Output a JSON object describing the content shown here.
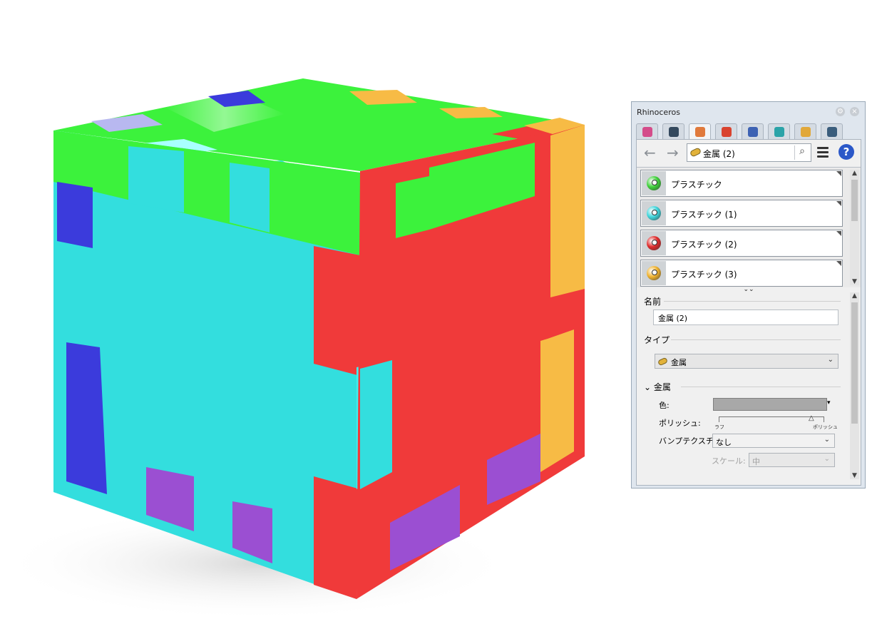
{
  "panel": {
    "title": "Rhinoceros",
    "tabs": [
      {
        "icon": "color-wheel-icon",
        "color": "#d44c8a"
      },
      {
        "icon": "environment-sphere-icon",
        "color": "#34495e"
      },
      {
        "icon": "materials-brush-icon",
        "color": "#e07a3c"
      },
      {
        "icon": "textures-icon",
        "color": "#d9432f"
      },
      {
        "icon": "render-settings-icon",
        "color": "#3d62b3"
      },
      {
        "icon": "ground-plane-icon",
        "color": "#2ba3a8"
      },
      {
        "icon": "libraries-folder-icon",
        "color": "#e1a83a"
      },
      {
        "icon": "rendering-icon",
        "color": "#3a5d7c"
      }
    ],
    "breadcrumb": "金属 (2)",
    "materials": [
      {
        "name": "プラスチック",
        "color": "#3fd13a"
      },
      {
        "name": "プラスチック (1)",
        "color": "#3fd6dc"
      },
      {
        "name": "プラスチック (2)",
        "color": "#e02b2b"
      },
      {
        "name": "プラスチック (3)",
        "color": "#f0b22e"
      }
    ],
    "props": {
      "name_section": "名前",
      "name_value": "金属 (2)",
      "type_section": "タイプ",
      "type_value": "金属",
      "metal_section": "金属",
      "color_label": "色:",
      "color_value": "#a8a8a8",
      "polish_label": "ポリッシュ:",
      "polish_min": "ラフ",
      "polish_max": "ポリッシュ",
      "polish_level": 0.95,
      "bump_label": "バンプテクスチ",
      "bump_value": "なし",
      "scale_label": "スケール:",
      "scale_value": "中"
    }
  },
  "cube": {
    "green": "#3cf23c",
    "cyan": "#33dede",
    "red": "#f03a3a",
    "blue": "#3b3bdc",
    "purple": "#9b4fd2",
    "orange": "#f7bb45"
  }
}
